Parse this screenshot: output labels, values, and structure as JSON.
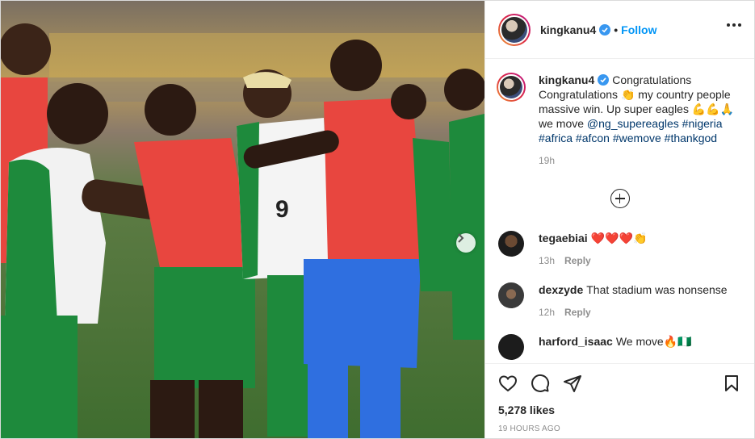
{
  "post": {
    "username": "kingkanu4",
    "follow_label": "Follow",
    "separator": "•",
    "more_icon": "more-horizontal-icon"
  },
  "caption": {
    "username": "kingkanu4",
    "line1": "Congratulations Congratulations 👏 my country people massive win. Up super eagles 💪💪🙏 we move",
    "mention": "@ng_supereagles",
    "tags": [
      "#nigeria",
      "#africa",
      "#afcon",
      "#wemove",
      "#thankgod"
    ],
    "time": "19h"
  },
  "comments": [
    {
      "username": "tegaebiai",
      "text": "❤️❤️❤️👏",
      "time": "13h",
      "reply": "Reply"
    },
    {
      "username": "dexzyde",
      "text": "That stadium was nonsense",
      "time": "12h",
      "reply": "Reply"
    },
    {
      "username": "harford_isaac",
      "text": "We move🔥🇳🇬",
      "time": "",
      "reply": ""
    }
  ],
  "actions": {
    "likes": "5,278 likes",
    "posted_ago": "19 HOURS AGO"
  },
  "colors": {
    "accent": "#0095f6",
    "link": "#00376b",
    "muted": "#8e8e8e",
    "kit_green": "#1e8a3c",
    "bib_red": "#e8463f",
    "kit_blue": "#2f6fe0"
  }
}
